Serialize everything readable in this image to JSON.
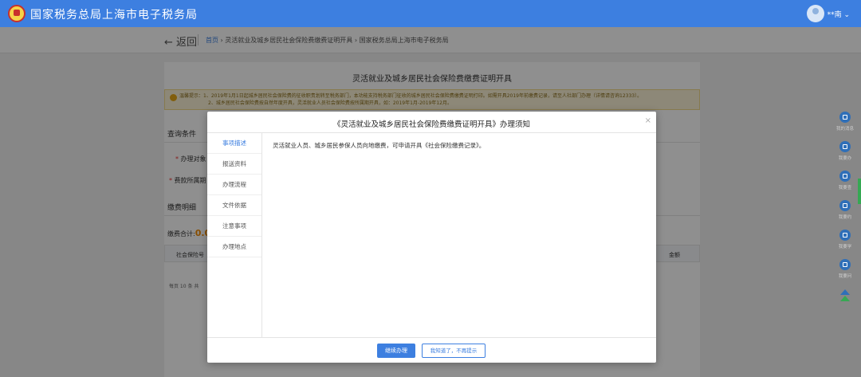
{
  "header": {
    "site_title": "国家税务总局上海市电子税务局",
    "user_name": "**南 ⌄"
  },
  "breadcrumb": {
    "back": "← 返回",
    "home": "首页",
    "path": " › 灵活就业及城乡居民社会保险费缴费证明开具 › 国家税务总局上海市电子税务局"
  },
  "page": {
    "title": "灵活就业及城乡居民社会保险费缴费证明开具",
    "notice_line1": "温馨提示：1、2019年1月1日起城乡居民社会保险费的征收职责划转至税务部门，本功能支持税务部门征收的城乡居民社会保险费缴费证明打印。如需开具2019年前缴费记录，请至人社部门办理（详情请咨询12333）。",
    "notice_line2": "2、城乡居民社会保险费按自然年度开具，灵活就业人员社会保险费按所属期开具，如：2019年1月-2019年12月。",
    "query_section": "查询条件",
    "field1_label": "办理对象",
    "field2_label": "费款所属期",
    "result_section": "缴费明细",
    "total_label": "缴费合计:",
    "total_value": "0.0",
    "col_first": "社会保险号",
    "col_last": "金额",
    "pager": "每页 10 条 共"
  },
  "right_nav": [
    {
      "label": "我的消息",
      "icon": "message-icon"
    },
    {
      "label": "我要办",
      "icon": "handle-icon"
    },
    {
      "label": "我要查",
      "icon": "search-icon"
    },
    {
      "label": "我要约",
      "icon": "appointment-icon"
    },
    {
      "label": "我要学",
      "icon": "learn-icon"
    },
    {
      "label": "我要问",
      "icon": "question-icon"
    },
    {
      "label": "",
      "icon": "top-icon"
    }
  ],
  "modal": {
    "title": "《灵活就业及城乡居民社会保险费缴费证明开具》办理须知",
    "close": "×",
    "tabs": [
      "事项描述",
      "报送资料",
      "办理流程",
      "文件依据",
      "注意事项",
      "办理地点"
    ],
    "active_tab": 0,
    "content": "灵活就业人员、城乡居民参保人员向地缴费，可申请开具《社会保险缴费记录》。",
    "primary_button": "继续办理",
    "secondary_button": "我知道了，不再提示"
  },
  "colors": {
    "brand_blue": "#3d7fe0",
    "nav_blue": "#2f6fb8",
    "accent_orange": "#f08a00"
  }
}
